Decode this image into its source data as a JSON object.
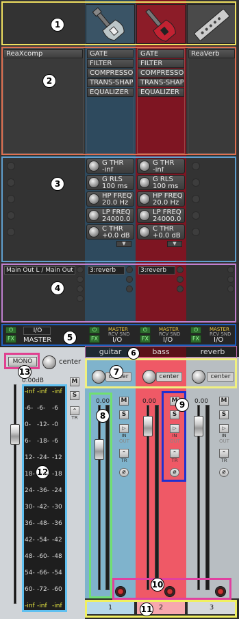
{
  "tracks": [
    {
      "id": "1",
      "name": "guitar",
      "color": "#3d5e74"
    },
    {
      "id": "2",
      "name": "bass",
      "color": "#9a1b2a"
    },
    {
      "id": "3",
      "name": "reverb",
      "color": "#3a3a3a"
    }
  ],
  "fx_slots": {
    "master": [
      "ReaXcomp"
    ],
    "guitar": [
      "GATE",
      "FILTER",
      "COMPRESSO",
      "TRANS-SHAPI",
      "EQUALIZER"
    ],
    "bass": [
      "GATE",
      "FILTER",
      "COMPRESSO",
      "TRANS-SHAPI",
      "EQUALIZER"
    ],
    "reverb": [
      "ReaVerb"
    ]
  },
  "params": {
    "guitar": [
      {
        "name": "G THR",
        "value": "-inf"
      },
      {
        "name": "G RLS",
        "value": "100 ms"
      },
      {
        "name": "HP FREQ",
        "value": "20.0 Hz"
      },
      {
        "name": "LP FREQ",
        "value": "24000.0 H"
      },
      {
        "name": "C THR",
        "value": "+0.0 dB"
      }
    ],
    "bass": [
      {
        "name": "G THR",
        "value": "-inf"
      },
      {
        "name": "G RLS",
        "value": "100 ms"
      },
      {
        "name": "HP FREQ",
        "value": "20.0 Hz"
      },
      {
        "name": "LP FREQ",
        "value": "24000.0 H"
      },
      {
        "name": "C THR",
        "value": "+0.0 dB"
      }
    ]
  },
  "sends": {
    "master": "Main Out L / Main Out",
    "guitar": "3:reverb",
    "bass": "3:reverb"
  },
  "strip": {
    "fx_label": "FX",
    "io_label": "I/O",
    "master_label": "MASTER",
    "route_master": "MASTER",
    "route_rcv_snd": "RCV SND"
  },
  "mixer": {
    "mono_label": "MONO",
    "pan_label": "center",
    "master_volume": "0.00dB",
    "track_volume": "0.00",
    "mute_label": "M",
    "solo_label": "S",
    "in_label": "IN",
    "out_label": "OUT",
    "tr_label": "TR",
    "meter_scale_left": [
      "-inf",
      "-6-",
      "0-",
      "6-",
      "12-",
      "18-",
      "24-",
      "30-",
      "36-",
      "42-",
      "48-",
      "54-",
      "60-",
      "-inf"
    ],
    "meter_scale_mid": [
      "-inf",
      "-6-",
      "-12-",
      "-18-",
      "-24-",
      "-30-",
      "-36-",
      "-42-",
      "-48-",
      "-54-",
      "-60-",
      "-66-",
      "-72-",
      "-inf"
    ],
    "meter_scale_right": [
      "-inf",
      "-6",
      "-0",
      "-6",
      "-12",
      "-18",
      "-24",
      "-30",
      "-36",
      "-42",
      "-48",
      "-54",
      "-60",
      "-inf"
    ]
  },
  "annotations": [
    "1",
    "2",
    "3",
    "4",
    "5",
    "6",
    "7",
    "8",
    "9",
    "10",
    "11",
    "12",
    "13"
  ],
  "annotation_colors": {
    "1": "#f0e060",
    "2": "#e07050",
    "3": "#60a0d0",
    "4": "#c080d0",
    "5": "#2060c0",
    "6": "#c070b0",
    "7": "#f0f080",
    "8": "#70e070",
    "9": "#2030d0",
    "10": "#e040a0",
    "11": "#f0f060",
    "12": "#60c0f0",
    "13": "#e04090"
  }
}
